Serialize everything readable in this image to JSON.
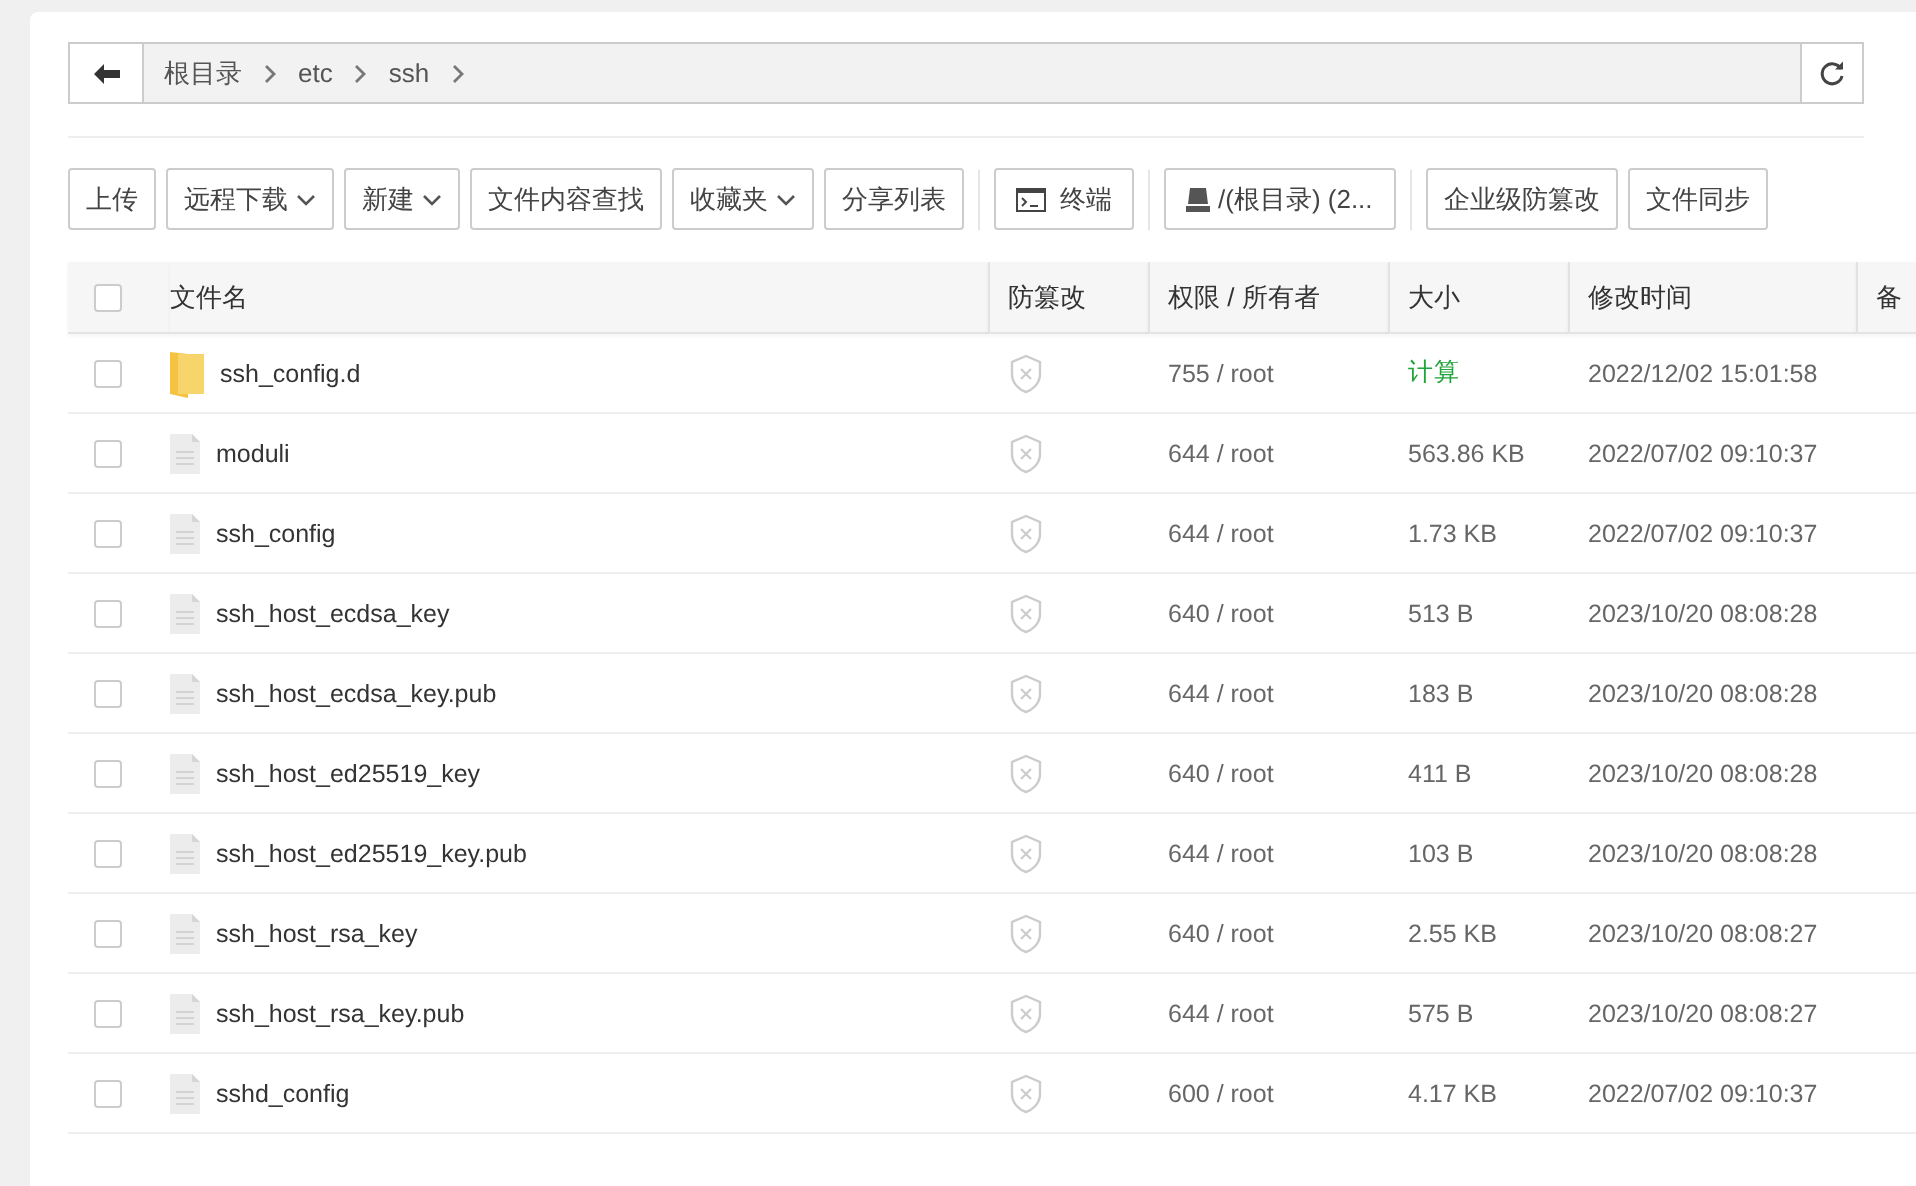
{
  "breadcrumb": {
    "path": [
      "根目录",
      "etc",
      "ssh"
    ]
  },
  "toolbar": {
    "groups": [
      [
        {
          "label": "上传",
          "kind": "plain"
        },
        {
          "label": "远程下载",
          "kind": "dropdown"
        },
        {
          "label": "新建",
          "kind": "dropdown"
        },
        {
          "label": "文件内容查找",
          "kind": "plain"
        },
        {
          "label": "收藏夹",
          "kind": "dropdown"
        },
        {
          "label": "分享列表",
          "kind": "plain"
        }
      ],
      [
        {
          "label": "终端",
          "kind": "terminal"
        }
      ],
      [
        {
          "label": "/(根目录) (2...",
          "kind": "disk"
        }
      ],
      [
        {
          "label": "企业级防篡改",
          "kind": "plain"
        },
        {
          "label": "文件同步",
          "kind": "plain"
        }
      ]
    ]
  },
  "table": {
    "columns": [
      "文件名",
      "防篡改",
      "权限 / 所有者",
      "大小",
      "修改时间",
      "备"
    ],
    "select_all": {
      "checked": false
    },
    "rows": [
      {
        "kind": "folder",
        "name": "ssh_config.d",
        "checked": false,
        "protected": false,
        "perm": "755 / root",
        "size": "计算",
        "modified": "2022/12/02 15:01:58"
      },
      {
        "kind": "file",
        "name": "moduli",
        "checked": false,
        "protected": false,
        "perm": "644 / root",
        "size": "563.86 KB",
        "modified": "2022/07/02 09:10:37"
      },
      {
        "kind": "file",
        "name": "ssh_config",
        "checked": false,
        "protected": false,
        "perm": "644 / root",
        "size": "1.73 KB",
        "modified": "2022/07/02 09:10:37"
      },
      {
        "kind": "file",
        "name": "ssh_host_ecdsa_key",
        "checked": false,
        "protected": false,
        "perm": "640 / root",
        "size": "513 B",
        "modified": "2023/10/20 08:08:28"
      },
      {
        "kind": "file",
        "name": "ssh_host_ecdsa_key.pub",
        "checked": false,
        "protected": false,
        "perm": "644 / root",
        "size": "183 B",
        "modified": "2023/10/20 08:08:28"
      },
      {
        "kind": "file",
        "name": "ssh_host_ed25519_key",
        "checked": false,
        "protected": false,
        "perm": "640 / root",
        "size": "411 B",
        "modified": "2023/10/20 08:08:28"
      },
      {
        "kind": "file",
        "name": "ssh_host_ed25519_key.pub",
        "checked": false,
        "protected": false,
        "perm": "644 / root",
        "size": "103 B",
        "modified": "2023/10/20 08:08:28"
      },
      {
        "kind": "file",
        "name": "ssh_host_rsa_key",
        "checked": false,
        "protected": false,
        "perm": "640 / root",
        "size": "2.55 KB",
        "modified": "2023/10/20 08:08:27"
      },
      {
        "kind": "file",
        "name": "ssh_host_rsa_key.pub",
        "checked": false,
        "protected": false,
        "perm": "644 / root",
        "size": "575 B",
        "modified": "2023/10/20 08:08:27"
      },
      {
        "kind": "file",
        "name": "sshd_config",
        "checked": false,
        "protected": false,
        "perm": "600 / root",
        "size": "4.17 KB",
        "modified": "2022/07/02 09:10:37"
      }
    ]
  }
}
